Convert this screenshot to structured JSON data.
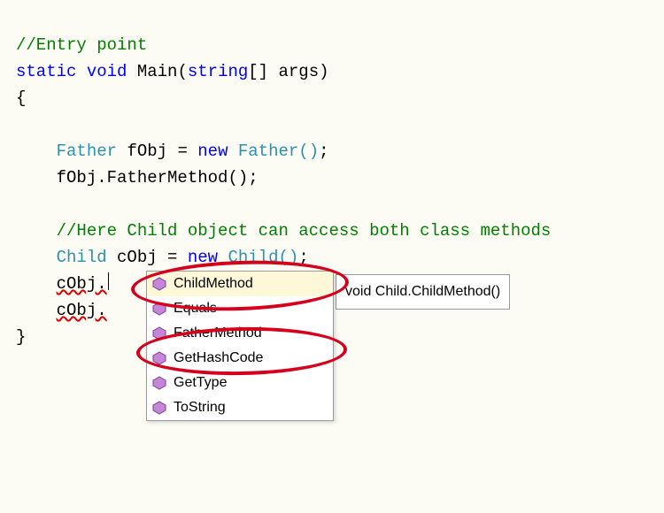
{
  "code": {
    "comment1": "//Entry point",
    "kw_static": "static",
    "kw_void": "void",
    "m_main": "Main",
    "p_open": "(",
    "kw_string": "string",
    "arr": "[]",
    "sp": " ",
    "args": "args",
    "p_close": ")",
    "brace_open": "{",
    "brace_close": "}",
    "t_father": "Father",
    "v_fobj": "fObj",
    "eq": " = ",
    "kw_new": "new",
    "ctor_father": "Father()",
    "semi": ";",
    "call_fatherMethod": "fObj.FatherMethod();",
    "comment2": "//Here Child object can access both class methods",
    "t_child": "Child",
    "v_cobj": "cObj",
    "ctor_child": "Child()",
    "line_cobj_dot": "cObj.",
    "line_cobj_dot2": "cObj."
  },
  "intellisense": {
    "items": [
      {
        "label": "ChildMethod",
        "selected": true
      },
      {
        "label": "Equals",
        "selected": false
      },
      {
        "label": "FatherMethod",
        "selected": false
      },
      {
        "label": "GetHashCode",
        "selected": false
      },
      {
        "label": "GetType",
        "selected": false
      },
      {
        "label": "ToString",
        "selected": false
      }
    ],
    "tooltip": "void Child.ChildMethod()"
  }
}
